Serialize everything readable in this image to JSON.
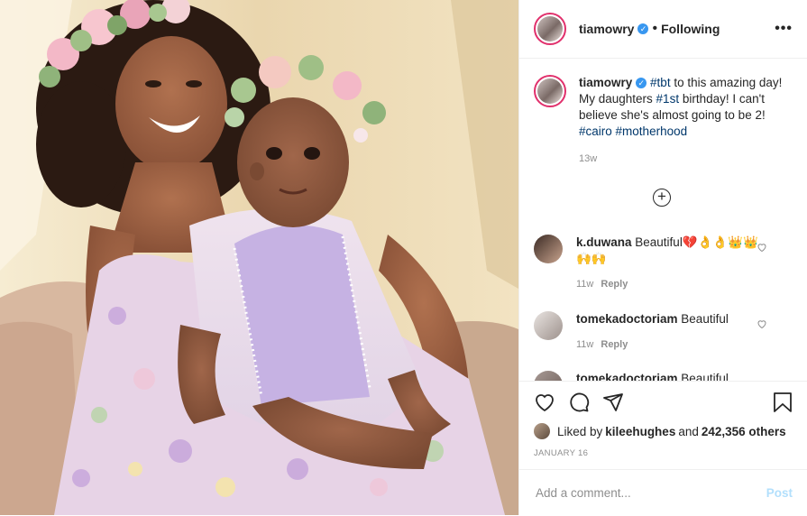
{
  "header": {
    "username": "tiamowry",
    "separator": "•",
    "follow_status": "Following",
    "more_icon": "more-horizontal-icon"
  },
  "caption": {
    "username": "tiamowry",
    "parts": [
      " ",
      "#tbt",
      " to this amazing day! My daughters ",
      "#1st",
      " birthday! I can't believe she's almost going to be 2! ",
      "#cairo",
      " ",
      "#motherhood"
    ],
    "time": "13w"
  },
  "comments": [
    {
      "username": "k.duwana",
      "text": "Beautiful💔👌👌👑👑🙌🙌",
      "time": "11w",
      "reply": "Reply"
    },
    {
      "username": "tomekadoctoriam",
      "text": "Beautiful",
      "time": "11w",
      "reply": "Reply"
    },
    {
      "username": "tomekadoctoriam",
      "text": "Beautiful",
      "time": "",
      "reply": ""
    }
  ],
  "likes": {
    "prefix": "Liked by ",
    "user": "kileehughes",
    "middle": " and ",
    "count": "242,356 others"
  },
  "date": "JANUARY 16",
  "add_comment": {
    "placeholder": "Add a comment...",
    "post_label": "Post"
  },
  "colors": {
    "link": "#00376b",
    "verified": "#3897f0",
    "muted": "#8e8e8e",
    "post_disabled": "#b2dffc"
  }
}
